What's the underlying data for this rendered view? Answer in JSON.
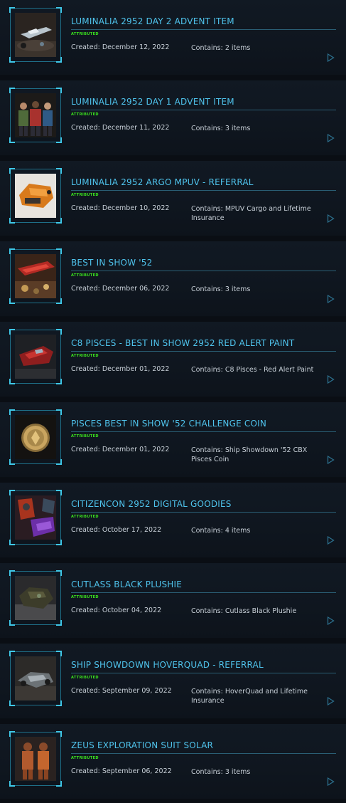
{
  "pledges": [
    {
      "title": "LUMINALIA 2952 DAY 2 ADVENT ITEM",
      "badge": "ATTRIBUTED",
      "created": "Created: December 12, 2022",
      "contains": "Contains: 2 items",
      "thumbnail": "ship-on-platform"
    },
    {
      "title": "LUMINALIA 2952 DAY 1 ADVENT ITEM",
      "badge": "ATTRIBUTED",
      "created": "Created: December 11, 2022",
      "contains": "Contains: 3 items",
      "thumbnail": "three-sweaters"
    },
    {
      "title": "LUMINALIA 2952 ARGO MPUV - REFERRAL",
      "badge": "ATTRIBUTED",
      "created": "Created: December 10, 2022",
      "contains": "Contains: MPUV Cargo and Lifetime Insurance",
      "thumbnail": "orange-mpuv"
    },
    {
      "title": "BEST IN SHOW '52",
      "badge": "ATTRIBUTED",
      "created": "Created: December 06, 2022",
      "contains": "Contains: 3 items",
      "thumbnail": "red-ship-coins"
    },
    {
      "title": "C8 PISCES - BEST IN SHOW 2952 RED ALERT PAINT",
      "badge": "ATTRIBUTED",
      "created": "Created: December 01, 2022",
      "contains": "Contains: C8 Pisces - Red Alert Paint",
      "thumbnail": "red-pisces"
    },
    {
      "title": "PISCES BEST IN SHOW '52 CHALLENGE COIN",
      "badge": "ATTRIBUTED",
      "created": "Created: December 01, 2022",
      "contains": "Contains: Ship Showdown '52 CBX Pisces Coin",
      "thumbnail": "gold-coin"
    },
    {
      "title": "CITIZENCON 2952 DIGITAL GOODIES",
      "badge": "ATTRIBUTED",
      "created": "Created: October 17, 2022",
      "contains": "Contains: 4 items",
      "thumbnail": "armor-purple"
    },
    {
      "title": "CUTLASS BLACK PLUSHIE",
      "badge": "ATTRIBUTED",
      "created": "Created: October 04, 2022",
      "contains": "Contains: Cutlass Black Plushie",
      "thumbnail": "plushie"
    },
    {
      "title": "SHIP SHOWDOWN HOVERQUAD - REFERRAL",
      "badge": "ATTRIBUTED",
      "created": "Created: September 09, 2022",
      "contains": "Contains: HoverQuad and Lifetime Insurance",
      "thumbnail": "hoverquad"
    },
    {
      "title": "ZEUS EXPLORATION SUIT SOLAR",
      "badge": "ATTRIBUTED",
      "created": "Created: September 06, 2022",
      "contains": "Contains: 3 items",
      "thumbnail": "orange-suits"
    }
  ],
  "colors": {
    "title": "#4fc3ec",
    "badge": "#3be61e",
    "text": "#c8d0d8",
    "frame": "#1e6f88"
  },
  "icons": {
    "expand": "play-arrow-icon"
  }
}
